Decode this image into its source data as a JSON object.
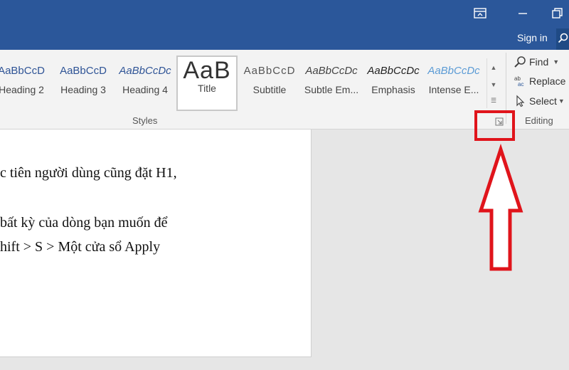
{
  "titlebar": {
    "signin_label": "Sign in",
    "icons": [
      "ribbon-display-options-icon",
      "minimize-icon",
      "restore-icon",
      "search-icon"
    ]
  },
  "ribbon": {
    "styles_gallery": [
      {
        "sample": "AaBbCcD",
        "name": "Heading 2"
      },
      {
        "sample": "AaBbCcD",
        "name": "Heading 3"
      },
      {
        "sample": "AaBbCcDc",
        "name": "Heading 4"
      },
      {
        "sample": "AaB",
        "name": "Title"
      },
      {
        "sample": "AaBbCcD",
        "name": "Subtitle"
      },
      {
        "sample": "AaBbCcDc",
        "name": "Subtle Em..."
      },
      {
        "sample": "AaBbCcDc",
        "name": "Emphasis"
      },
      {
        "sample": "AaBbCcDc",
        "name": "Intense E..."
      }
    ],
    "styles_group_label": "Styles",
    "editing": {
      "find_label": "Find",
      "replace_label": "Replace",
      "select_label": "Select",
      "group_label": "Editing"
    }
  },
  "document": {
    "lines": [
      "c tiên người dùng cũng đặt H1,",
      "bất kỳ của dòng bạn muốn để",
      "hift > S > Một cửa sổ Apply"
    ]
  },
  "colors": {
    "titlebar": "#2b579a",
    "ribbon": "#f3f3f3",
    "annotation": "#e0141b"
  }
}
